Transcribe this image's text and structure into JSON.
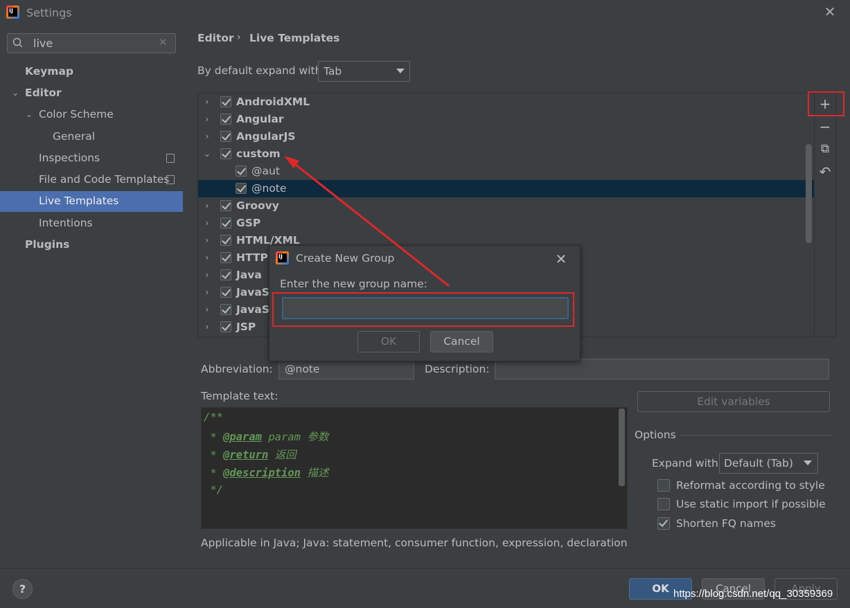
{
  "window": {
    "title": "Settings",
    "close": "✕"
  },
  "search": {
    "value": "live",
    "clear": "✕"
  },
  "sidebar": {
    "items": [
      {
        "label": "Keymap"
      },
      {
        "label": "Editor"
      },
      {
        "label": "Color Scheme"
      },
      {
        "label": "General"
      },
      {
        "label": "Inspections"
      },
      {
        "label": "File and Code Templates"
      },
      {
        "label": "Live Templates"
      },
      {
        "label": "Intentions"
      },
      {
        "label": "Plugins"
      }
    ]
  },
  "breadcrumb": {
    "parent": "Editor",
    "sep": "›",
    "current": "Live Templates"
  },
  "expand": {
    "label": "By default expand with",
    "value": "Tab"
  },
  "tree": {
    "groups": [
      {
        "label": "AndroidXML"
      },
      {
        "label": "Angular"
      },
      {
        "label": "AngularJS"
      },
      {
        "label": "custom"
      },
      {
        "label": "@aut"
      },
      {
        "label": "@note"
      },
      {
        "label": "Groovy"
      },
      {
        "label": "GSP"
      },
      {
        "label": "HTML/XML"
      },
      {
        "label": "HTTP I"
      },
      {
        "label": "Java"
      },
      {
        "label": "JavaSc"
      },
      {
        "label": "JavaSc"
      },
      {
        "label": "JSP"
      }
    ]
  },
  "toolbar": {
    "add": "+",
    "remove": "−",
    "copy": "⧉",
    "revert": "↶"
  },
  "details": {
    "abbr_label": "Abbreviation:",
    "abbr_value": "@note",
    "desc_label": "Description:",
    "desc_value": "",
    "template_label": "Template text:",
    "code": {
      "l1": "/**",
      "l2_prefix": " * ",
      "l2_tag": "@param",
      "l2_rest": " param 参数",
      "l3_prefix": " * ",
      "l3_tag": "@return",
      "l3_rest": " 返回",
      "l4_prefix": " * ",
      "l4_tag": "@description",
      "l4_rest": " 描述",
      "l5": " */"
    },
    "applicable": "Applicable in Java; Java: statement, consumer function, expression, declaration, comr",
    "edit_vars": "Edit variables",
    "options_label": "Options",
    "expand_with_label": "Expand with",
    "expand_with_value": "Default (Tab)",
    "opt_reformat": "Reformat according to style",
    "opt_static": "Use static import if possible",
    "opt_shorten": "Shorten FQ names"
  },
  "dialog": {
    "title": "Create New Group",
    "close": "✕",
    "prompt": "Enter the new group name:",
    "value": "",
    "ok": "OK",
    "cancel": "Cancel"
  },
  "footer": {
    "help": "?",
    "ok": "OK",
    "cancel": "Cancel",
    "apply": "Apply"
  },
  "watermark": "https://blog.csdn.net/qq_30359369",
  "colors": {
    "accent": "#4b6eaf",
    "highlight": "#e0272a",
    "selection": "#0d293e"
  }
}
